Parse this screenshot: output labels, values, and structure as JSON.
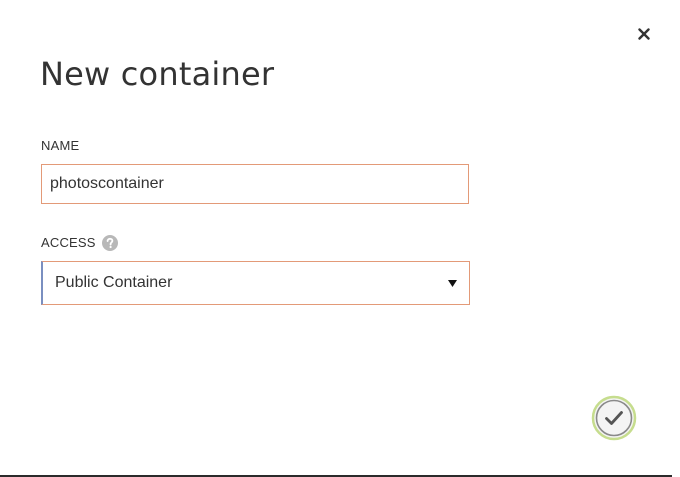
{
  "dialog": {
    "title": "New container",
    "close_icon": "close-icon",
    "confirm_icon": "checkmark-circle-icon"
  },
  "fields": {
    "name": {
      "label": "NAME",
      "value": "photoscontainer"
    },
    "access": {
      "label": "ACCESS",
      "help_icon": "help-icon",
      "selected": "Public Container",
      "dropdown_icon": "dropdown-arrow-icon"
    }
  },
  "colors": {
    "input_border": "#e39a78",
    "confirm_ring": "#c6dd8e",
    "confirm_fill": "#f4f4f4",
    "help_icon": "#b8b8b8"
  }
}
